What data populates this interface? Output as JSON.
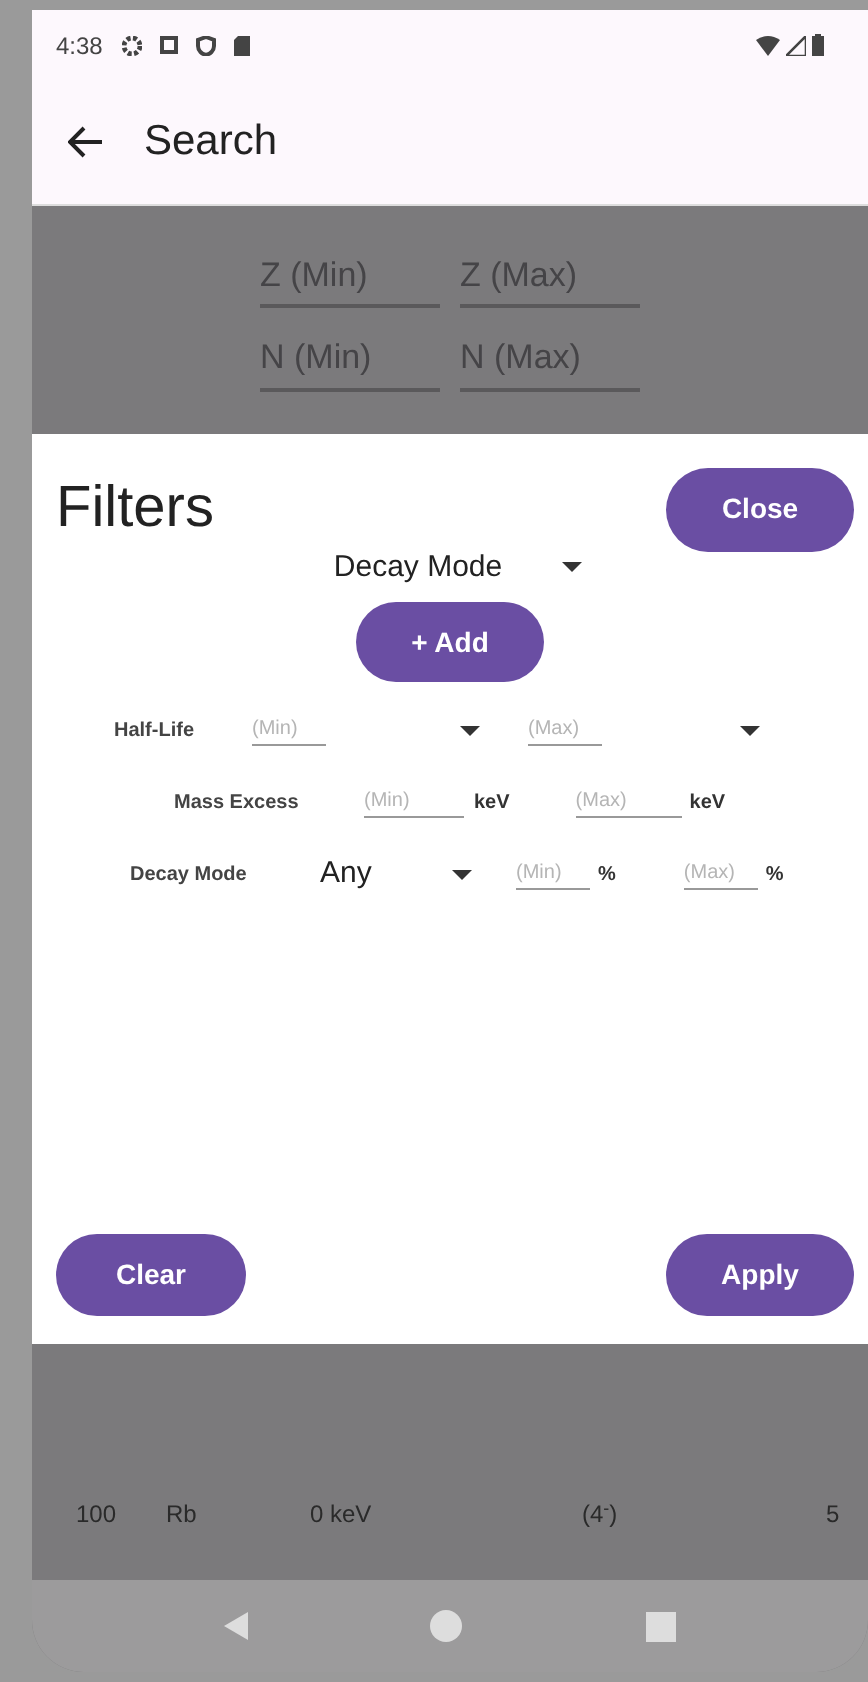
{
  "status_bar": {
    "time": "4:38"
  },
  "app_bar": {
    "title": "Search"
  },
  "background_fields": [
    {
      "placeholder": "Z (Min)"
    },
    {
      "placeholder": "Z (Max)"
    },
    {
      "placeholder": "N (Min)"
    },
    {
      "placeholder": "N (Max)"
    }
  ],
  "sheet": {
    "title": "Filters",
    "close_button": "Close",
    "add_selector": {
      "value": "Decay Mode"
    },
    "add_button": "+ Add",
    "filters": [
      {
        "kind": "range_select",
        "label": "Half-Life",
        "min_placeholder": "(Min)",
        "max_placeholder": "(Max)"
      },
      {
        "kind": "range_unit",
        "label": "Mass Excess",
        "min_placeholder": "(Min)",
        "max_placeholder": "(Max)",
        "min_unit": "keV",
        "max_unit": "keV"
      },
      {
        "kind": "select_range",
        "label": "Decay Mode",
        "value": "Any",
        "min_placeholder": "(Min)",
        "max_placeholder": "(Max)",
        "min_unit": "%",
        "max_unit": "%"
      }
    ],
    "clear_button": "Clear",
    "apply_button": "Apply"
  },
  "background_row": [
    "100",
    "Rb",
    "0 keV",
    "(4$^{-}$)",
    "5"
  ]
}
